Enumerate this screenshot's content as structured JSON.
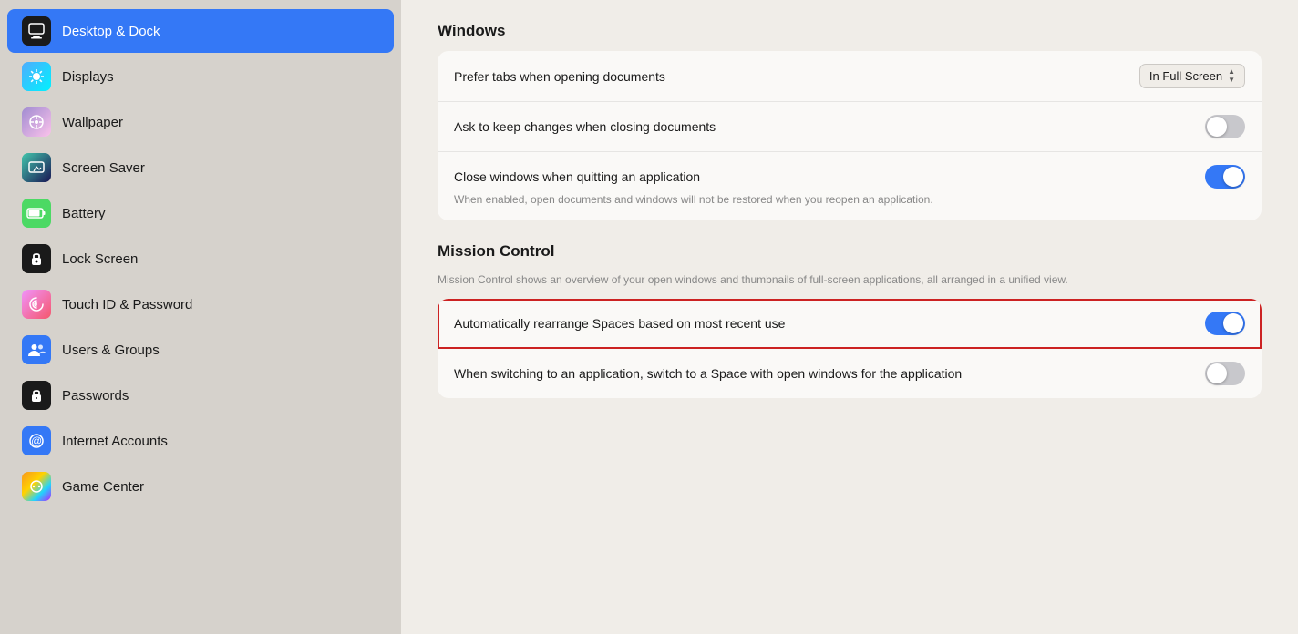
{
  "sidebar": {
    "items": [
      {
        "id": "desktop-dock",
        "label": "Desktop & Dock",
        "icon": "desktop",
        "active": true
      },
      {
        "id": "displays",
        "label": "Displays",
        "icon": "displays",
        "active": false
      },
      {
        "id": "wallpaper",
        "label": "Wallpaper",
        "icon": "wallpaper",
        "active": false
      },
      {
        "id": "screen-saver",
        "label": "Screen Saver",
        "icon": "screensaver",
        "active": false
      },
      {
        "id": "battery",
        "label": "Battery",
        "icon": "battery",
        "active": false
      },
      {
        "id": "lock-screen",
        "label": "Lock Screen",
        "icon": "lockscreen",
        "active": false
      },
      {
        "id": "touch-id",
        "label": "Touch ID & Password",
        "icon": "touchid",
        "active": false
      },
      {
        "id": "users-groups",
        "label": "Users & Groups",
        "icon": "users",
        "active": false
      },
      {
        "id": "passwords",
        "label": "Passwords",
        "icon": "passwords",
        "active": false
      },
      {
        "id": "internet-accounts",
        "label": "Internet Accounts",
        "icon": "internet",
        "active": false
      },
      {
        "id": "game-center",
        "label": "Game Center",
        "icon": "gamecenter",
        "active": false
      }
    ]
  },
  "main": {
    "windows_section": {
      "title": "Windows",
      "rows": [
        {
          "label": "Prefer tabs when opening documents",
          "type": "stepper",
          "value": "In Full Screen"
        },
        {
          "label": "Ask to keep changes when closing documents",
          "type": "toggle",
          "on": false
        },
        {
          "label": "Close windows when quitting an application",
          "description": "When enabled, open documents and windows will not be restored when you reopen an application.",
          "type": "toggle",
          "on": true
        }
      ]
    },
    "mission_section": {
      "title": "Mission Control",
      "description": "Mission Control shows an overview of your open windows and thumbnails of full-screen applications, all arranged in a unified view.",
      "rows": [
        {
          "label": "Automatically rearrange Spaces based on most recent use",
          "type": "toggle",
          "on": true,
          "highlighted": true
        },
        {
          "label": "When switching to an application, switch to a Space with open windows for the application",
          "type": "toggle",
          "on": false
        }
      ]
    }
  },
  "icons": {
    "desktop": "▣",
    "displays": "☀",
    "wallpaper": "✿",
    "screensaver": "🌙",
    "battery": "▬",
    "lockscreen": "🔒",
    "touchid": "◎",
    "users": "👥",
    "passwords": "🔑",
    "internet": "@",
    "gamecenter": "◉"
  }
}
